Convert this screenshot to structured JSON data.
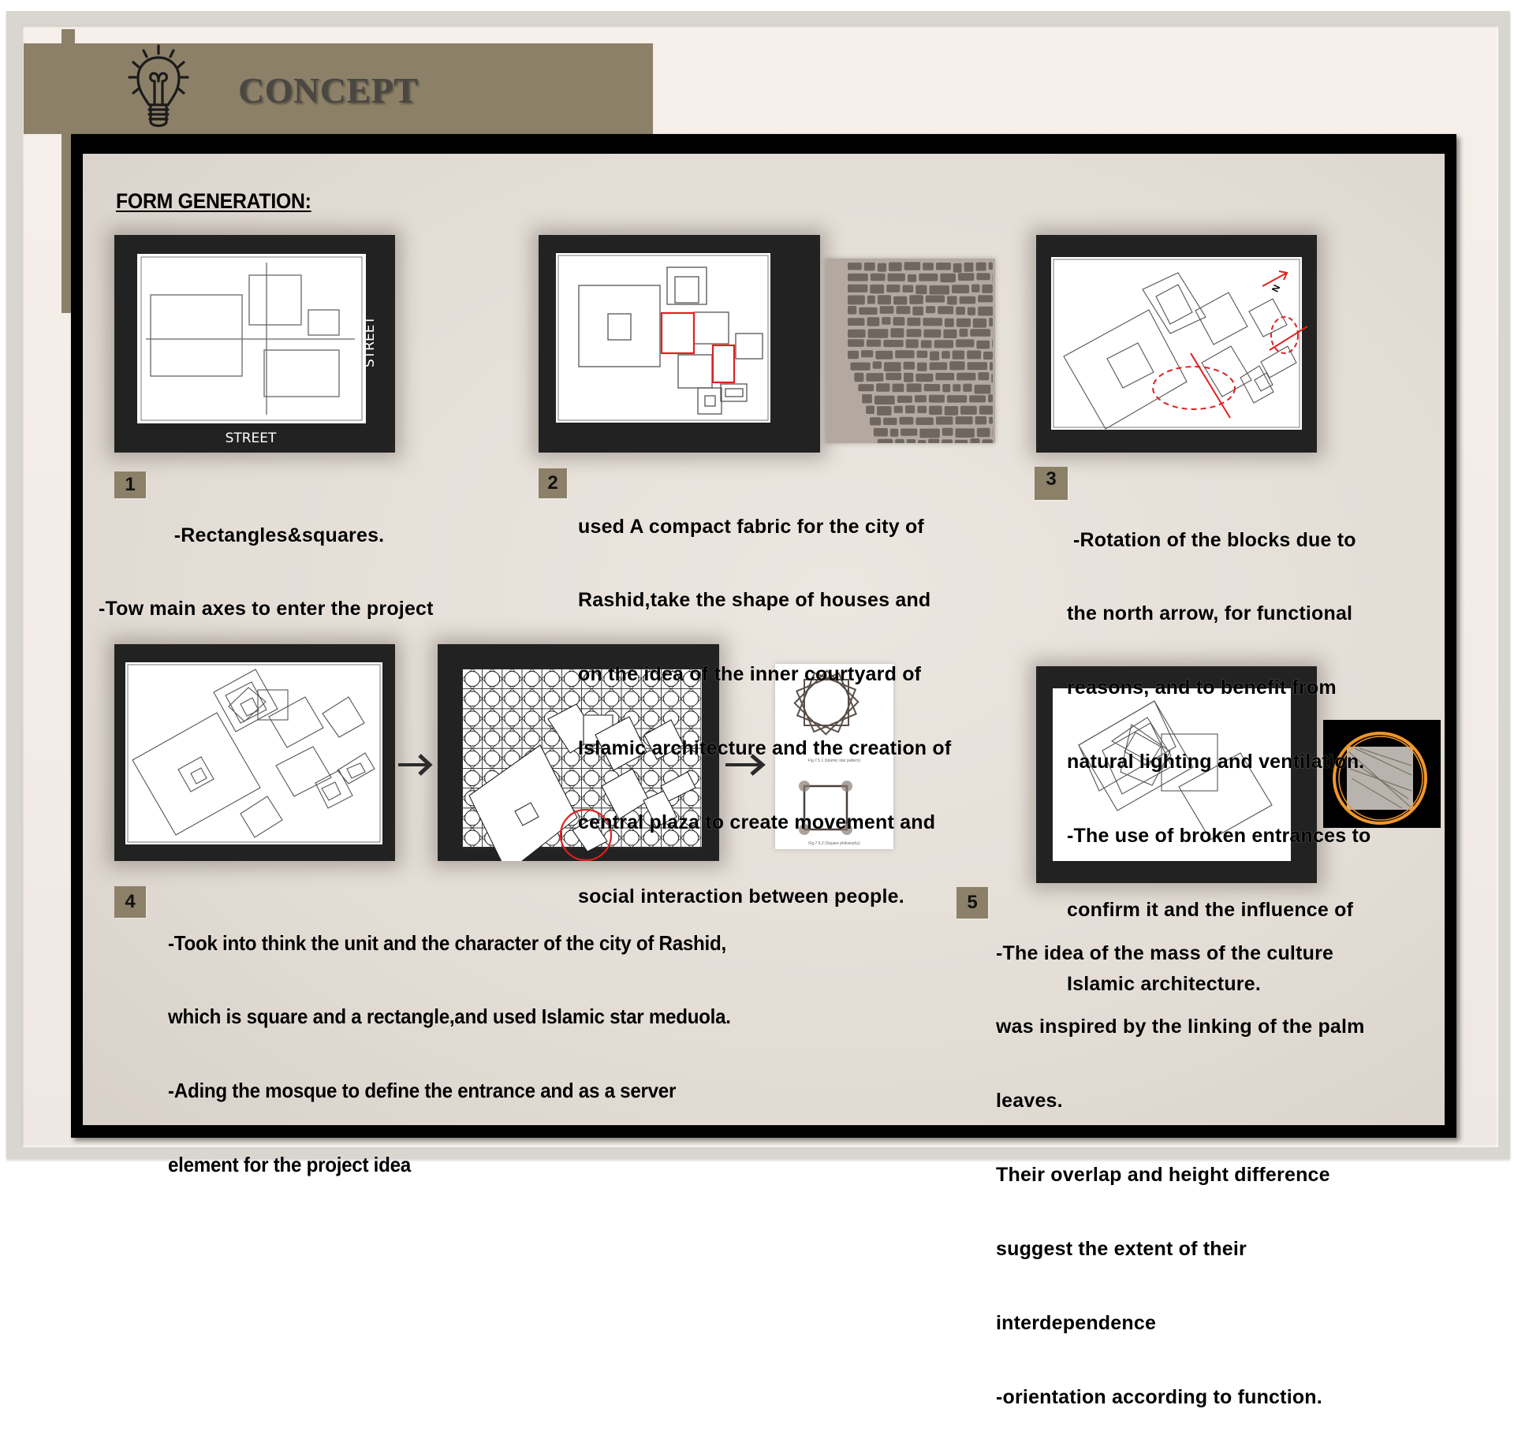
{
  "header": {
    "title": "CONCEPT",
    "icon": "lightbulb-icon",
    "band_color": "#8c8068"
  },
  "section": {
    "title": "FORM GENERATION:"
  },
  "steps": [
    {
      "number": "1",
      "lines": [
        "     -Rectangles&squares.",
        "-Tow main axes to enter the project"
      ],
      "diagram": {
        "street_bottom": "STREET",
        "street_right": "STREET"
      }
    },
    {
      "number": "2",
      "lines": [
        "used A compact fabric for the city of",
        "Rashid,take the shape of houses and",
        "on the idea of the inner courtyard of",
        "Islamic architecture and the creation of",
        "central plaza to create movement and",
        "social interaction between people."
      ],
      "reference_image": "aerial-map-of-rashid-urban-fabric"
    },
    {
      "number": "3",
      "lines": [
        "-Rotation of the blocks due to",
        "the north arrow, for functional",
        "reasons, and to benefit from",
        "natural lighting and ventilation.",
        "-The use of broken entrances to",
        "confirm it and the influence of",
        "Islamic architecture."
      ],
      "diagram": {
        "north_label": "N"
      }
    },
    {
      "number": "4",
      "lines": [
        "-Took into think the unit and the character of the city of Rashid,",
        "which is square and a rectangle,and used Islamic star meduola.",
        "-Ading the mosque to define the entrance and as a server",
        "element for the project idea"
      ],
      "figure_captions": [
        "Fig.7.5.1 (Islamic star pattern)",
        "Fig.7.5.2 (Square philosophy)"
      ]
    },
    {
      "number": "5",
      "lines": [
        "-The idea of the mass of the culture",
        "was inspired by the linking of the palm",
        "leaves.",
        "Their overlap and height difference",
        "suggest the extent of their",
        "interdependence",
        "-orientation according to function."
      ],
      "reference_image": "palm-leaves-linking"
    }
  ],
  "colors": {
    "accent_red": "#e02020",
    "panel_dark": "#222222",
    "badge": "#8c8068",
    "palm_ring": "#f0962a"
  }
}
